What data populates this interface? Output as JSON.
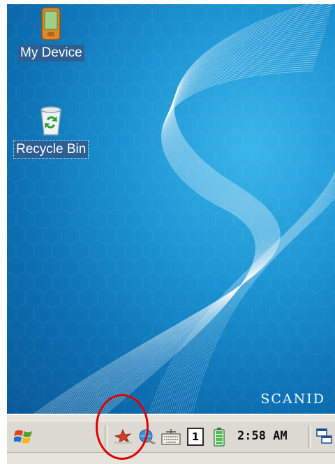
{
  "desktop": {
    "icons": [
      {
        "label": "My Device",
        "icon": "pda-device-icon"
      },
      {
        "label": "Recycle Bin",
        "icon": "recycle-bin-icon"
      }
    ],
    "brand_text": "SCANID",
    "wallpaper_colors": {
      "deep": "#0a5a99",
      "mid": "#1b93d2",
      "light": "#3bb6ea"
    }
  },
  "taskbar": {
    "start_icon": "windows-flag-icon",
    "tray": {
      "icons": [
        "network-star-icon",
        "connectivity-globe-icon",
        "keyboard-icon",
        "input-mode-icon",
        "battery-icon",
        "desktop-icon"
      ],
      "input_mode": "1",
      "clock": "2:58 AM"
    }
  },
  "annotation": {
    "shape": "circle",
    "color": "#e00000",
    "target": "network-star-icon"
  }
}
